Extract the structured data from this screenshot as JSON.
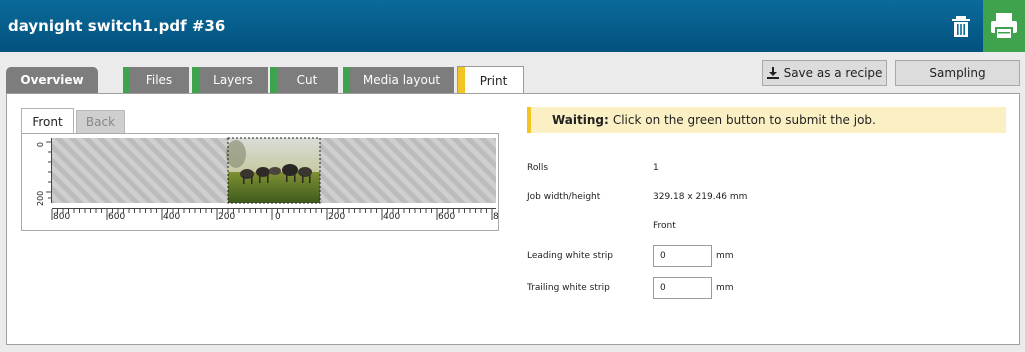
{
  "window": {
    "title": "daynight switch1.pdf #36"
  },
  "icons": {
    "trash": "trash-icon",
    "print": "printer-icon",
    "download": "download-icon"
  },
  "colors": {
    "titlebar": "#03527e",
    "print_button": "#3fa34d",
    "tab_done_marker": "#3fa34d",
    "tab_active_marker": "#f3c423",
    "banner_bg": "#fbf0c4"
  },
  "tabs": [
    {
      "label": "Overview"
    },
    {
      "label": "Files"
    },
    {
      "label": "Layers"
    },
    {
      "label": "Cut"
    },
    {
      "label": "Media layout"
    },
    {
      "label": "Print"
    }
  ],
  "actions": {
    "save_recipe": "Save as a recipe",
    "sampling": "Sampling"
  },
  "preview": {
    "side_tabs": {
      "front": "Front",
      "back": "Back"
    },
    "hruler": [
      "800",
      "600",
      "400",
      "200",
      "0",
      "200",
      "400",
      "600",
      "8"
    ],
    "vruler": [
      "0",
      "200"
    ]
  },
  "status": {
    "state": "Waiting:",
    "message": "Click on the green button to submit the job."
  },
  "info": {
    "rolls_label": "Rolls",
    "rolls_value": "1",
    "size_label": "Job width/height",
    "size_value": "329.18 x 219.46 mm",
    "side_value": "Front",
    "leading_label": "Leading white strip",
    "leading_value": "0",
    "leading_unit": "mm",
    "trailing_label": "Trailing white strip",
    "trailing_value": "0",
    "trailing_unit": "mm"
  }
}
